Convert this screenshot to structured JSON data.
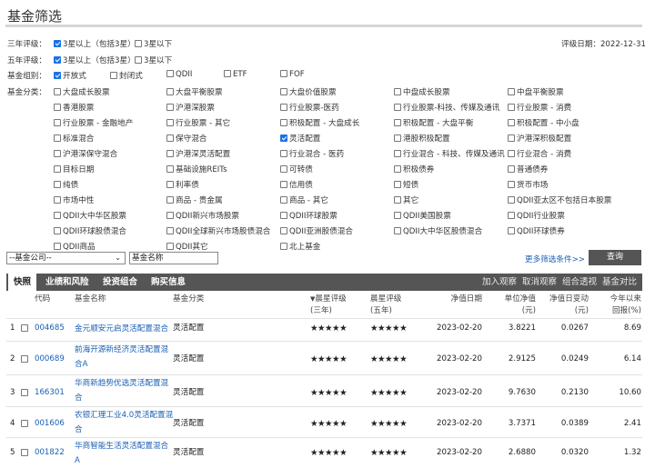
{
  "page_title": "基金筛选",
  "rating_date": "评级日期：2022-12-31",
  "three_year": {
    "label": "三年评级：",
    "options": [
      {
        "text": "3星以上（包括3星）",
        "checked": true
      },
      {
        "text": "3星以下",
        "checked": false
      }
    ]
  },
  "five_year": {
    "label": "五年评级：",
    "options": [
      {
        "text": "3星以上（包括3星）",
        "checked": true
      },
      {
        "text": "3星以下",
        "checked": false
      }
    ]
  },
  "fund_group": {
    "label": "基金组别：",
    "options": [
      {
        "text": "开放式",
        "checked": true
      },
      {
        "text": "封闭式",
        "checked": false
      },
      {
        "text": "QDII",
        "checked": false
      },
      {
        "text": "ETF",
        "checked": false
      },
      {
        "text": "FOF",
        "checked": false
      }
    ]
  },
  "fund_category": {
    "label": "基金分类：",
    "options": [
      "大盘成长股票",
      "大盘平衡股票",
      "大盘价值股票",
      "中盘成长股票",
      "中盘平衡股票",
      "香港股票",
      "沪港深股票",
      "行业股票-医药",
      "行业股票-科技、传媒及通讯",
      "行业股票 - 消费",
      "行业股票 - 金融地产",
      "行业股票 - 其它",
      "积极配置 - 大盘成长",
      "积极配置 - 大盘平衡",
      "积极配置 - 中小盘",
      "标准混合",
      "保守混合",
      "灵活配置",
      "港股积极配置",
      "沪港深积极配置",
      "沪港深保守混合",
      "沪港深灵活配置",
      "行业混合 - 医药",
      "行业混合 - 科技、传媒及通讯",
      "行业混合 - 消费",
      "目标日期",
      "基础设施REITs",
      "可转债",
      "积极债券",
      "普通债券",
      "纯债",
      "利率债",
      "信用债",
      "短债",
      "货币市场",
      "市场中性",
      "商品 - 贵金属",
      "商品 - 其它",
      "其它",
      "QDII亚太区不包括日本股票",
      "QDII大中华区股票",
      "QDII新兴市场股票",
      "QDII环球股票",
      "QDII美国股票",
      "QDII行业股票",
      "QDII环球股债混合",
      "QDII全球新兴市场股债混合",
      "QDII亚洲股债混合",
      "QDII大中华区股债混合",
      "QDII环球债券",
      "QDII商品",
      "QDII其它",
      "北上基金"
    ],
    "checked_index": 17
  },
  "company_select": "--基金公司--",
  "name_input": "基金名称",
  "more_conditions": "更多筛选条件>>",
  "query_button": "查询",
  "tabs": [
    "快照",
    "业绩和风险",
    "投资组合",
    "购买信息"
  ],
  "actions": [
    "加入观察",
    "取消观察",
    "组合透视",
    "基金对比"
  ],
  "columns": {
    "code": "代码",
    "name": "基金名称",
    "category": "基金分类",
    "rating3": [
      "晨星评级",
      "(三年)"
    ],
    "rating5": [
      "晨星评级",
      "(五年)"
    ],
    "nav_date": "净值日期",
    "nav": [
      "单位净值",
      "(元)"
    ],
    "nav_change": [
      "净值日变动",
      "(元)"
    ],
    "ytd": [
      "今年以来",
      "回报(%)"
    ]
  },
  "rows": [
    {
      "idx": "1",
      "code": "004685",
      "name": [
        "金元顺安元启灵活配置混合"
      ],
      "category": "灵活配置",
      "r3": "★★★★★",
      "r5": "★★★★★",
      "date": "2023-02-20",
      "nav": "3.8221",
      "chg": "0.0267",
      "ytd": "8.69"
    },
    {
      "idx": "2",
      "code": "000689",
      "name": [
        "前海开源新经济灵活配置混",
        "合A"
      ],
      "category": "灵活配置",
      "r3": "★★★★★",
      "r5": "★★★★★",
      "date": "2023-02-20",
      "nav": "2.9125",
      "chg": "0.0249",
      "ytd": "6.14"
    },
    {
      "idx": "3",
      "code": "166301",
      "name": [
        "华商新趋势优选灵活配置混",
        "合"
      ],
      "category": "灵活配置",
      "r3": "★★★★★",
      "r5": "★★★★★",
      "date": "2023-02-20",
      "nav": "9.7630",
      "chg": "0.2130",
      "ytd": "10.60"
    },
    {
      "idx": "4",
      "code": "001606",
      "name": [
        "农银汇理工业4.0灵活配置混",
        "合"
      ],
      "category": "灵活配置",
      "r3": "★★★★★",
      "r5": "★★★★★",
      "date": "2023-02-20",
      "nav": "3.7371",
      "chg": "0.0389",
      "ytd": "2.41"
    },
    {
      "idx": "5",
      "code": "001822",
      "name": [
        "华商智能生活灵活配置混合",
        "A"
      ],
      "category": "灵活配置",
      "r3": "★★★★★",
      "r5": "★★★★★",
      "date": "2023-02-20",
      "nav": "2.6880",
      "chg": "0.0320",
      "ytd": "1.32"
    }
  ]
}
